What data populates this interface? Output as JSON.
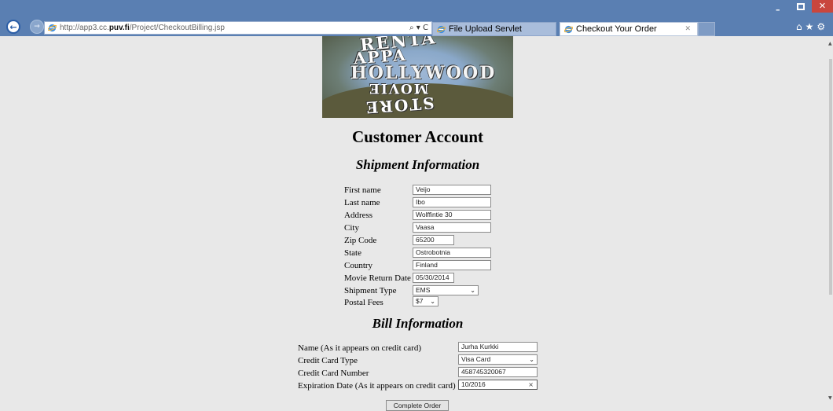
{
  "browser": {
    "url_prefix": "http://app3.cc.",
    "url_domain": "puv.fi",
    "url_path": "/Project/CheckoutBilling.jsp",
    "addr_tools": "⌕ ▾ C",
    "tabs": [
      {
        "label": "File Upload Servlet"
      },
      {
        "label": "Checkout Your Order",
        "close": "✕"
      }
    ],
    "window_min": "–",
    "window_close": "✕",
    "toolbar_icons": "⌂★⚙"
  },
  "banner": {
    "word1": "RENTA",
    "word2": "APPA",
    "word3": "HOLLYWOOD",
    "word4": "MOVIE",
    "word5": "STORE"
  },
  "page": {
    "title": "Customer Account"
  },
  "shipment": {
    "title": "Shipment Information",
    "fields": [
      {
        "label": "First name",
        "value": "Veijo"
      },
      {
        "label": "Last name",
        "value": "Ibo"
      },
      {
        "label": "Address",
        "value": "Wolffintie 30"
      },
      {
        "label": "City",
        "value": "Vaasa"
      },
      {
        "label": "Zip Code",
        "value": "65200"
      },
      {
        "label": "State",
        "value": "Ostrobotnia"
      },
      {
        "label": "Country",
        "value": "Finland"
      },
      {
        "label": "Movie Return Date",
        "value": "05/30/2014"
      },
      {
        "label": "Shipment Type",
        "value": "EMS"
      },
      {
        "label": "Postal Fees",
        "value": "$7"
      }
    ]
  },
  "bill": {
    "title": "Bill Information",
    "fields": [
      {
        "label": "Name (As it appears on credit card)",
        "value": "Jurha Kurkki"
      },
      {
        "label": "Credit Card Type",
        "value": "Visa Card"
      },
      {
        "label": "Credit Card Number",
        "value": "458745320067"
      },
      {
        "label": "Expiration Date (As it appears on credit card)",
        "value": "10/2016",
        "clear": "×"
      }
    ]
  },
  "actions": {
    "complete_order": "Complete Order"
  },
  "icons": {
    "chevron": "⌄"
  }
}
